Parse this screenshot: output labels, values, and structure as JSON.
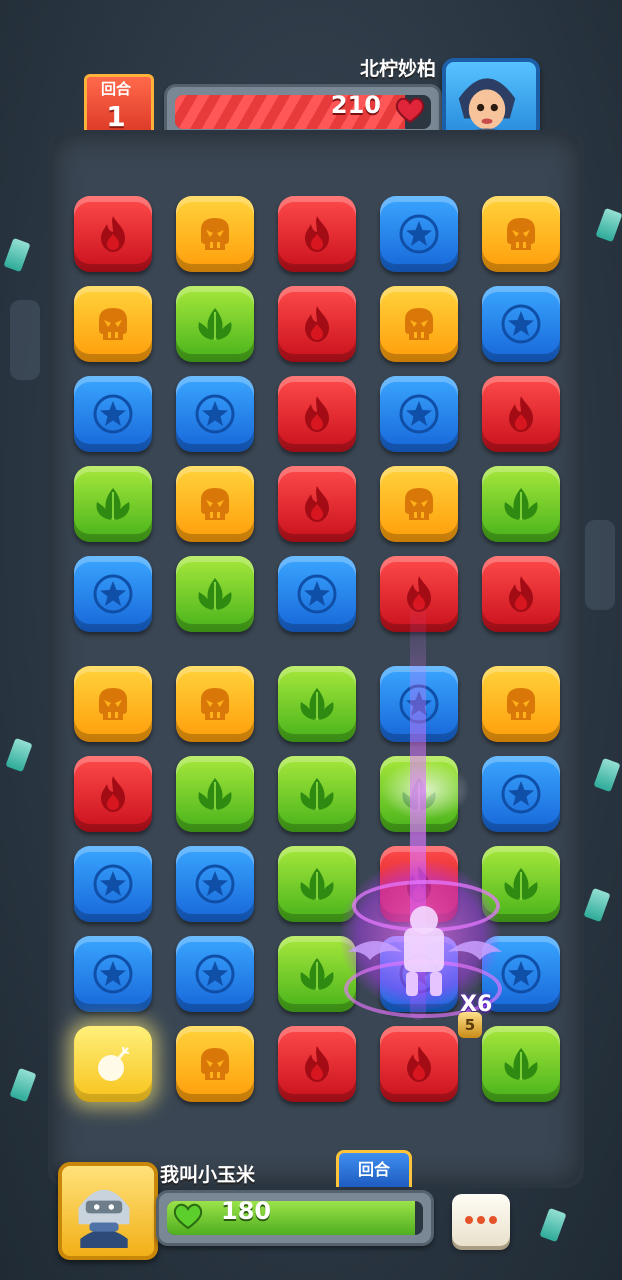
{
  "round": {
    "label": "回合",
    "number": "1"
  },
  "enemy": {
    "name": "北柠妙柏",
    "hp": "210",
    "hp_fraction": 0.9
  },
  "player": {
    "name": "我叫小玉米",
    "hp": "180",
    "hp_fraction": 0.97
  },
  "turn_indicator": {
    "label": "回合"
  },
  "combo": {
    "text": "X6",
    "sub": "5"
  },
  "colors": {
    "fire": "#d8161f",
    "skull": "#ffb21a",
    "star": "#1f76e3",
    "leaf": "#6ccb25",
    "bomb": "#fbd531"
  },
  "board": [
    [
      "fire",
      "skull",
      "fire",
      "star",
      "skull"
    ],
    [
      "skull",
      "leaf",
      "fire",
      "skull",
      "star"
    ],
    [
      "star",
      "star",
      "fire",
      "star",
      "fire"
    ],
    [
      "leaf",
      "skull",
      "fire",
      "skull",
      "leaf"
    ],
    [
      "star",
      "leaf",
      "star",
      "fire",
      "fire"
    ],
    [
      "skull",
      "skull",
      "leaf",
      "star",
      "skull"
    ],
    [
      "fire",
      "leaf",
      "leaf",
      "leaf",
      "star"
    ],
    [
      "star",
      "star",
      "leaf",
      "fire",
      "leaf"
    ],
    [
      "star",
      "star",
      "leaf",
      "star",
      "star"
    ],
    [
      "bomb",
      "skull",
      "fire",
      "fire",
      "leaf"
    ]
  ]
}
